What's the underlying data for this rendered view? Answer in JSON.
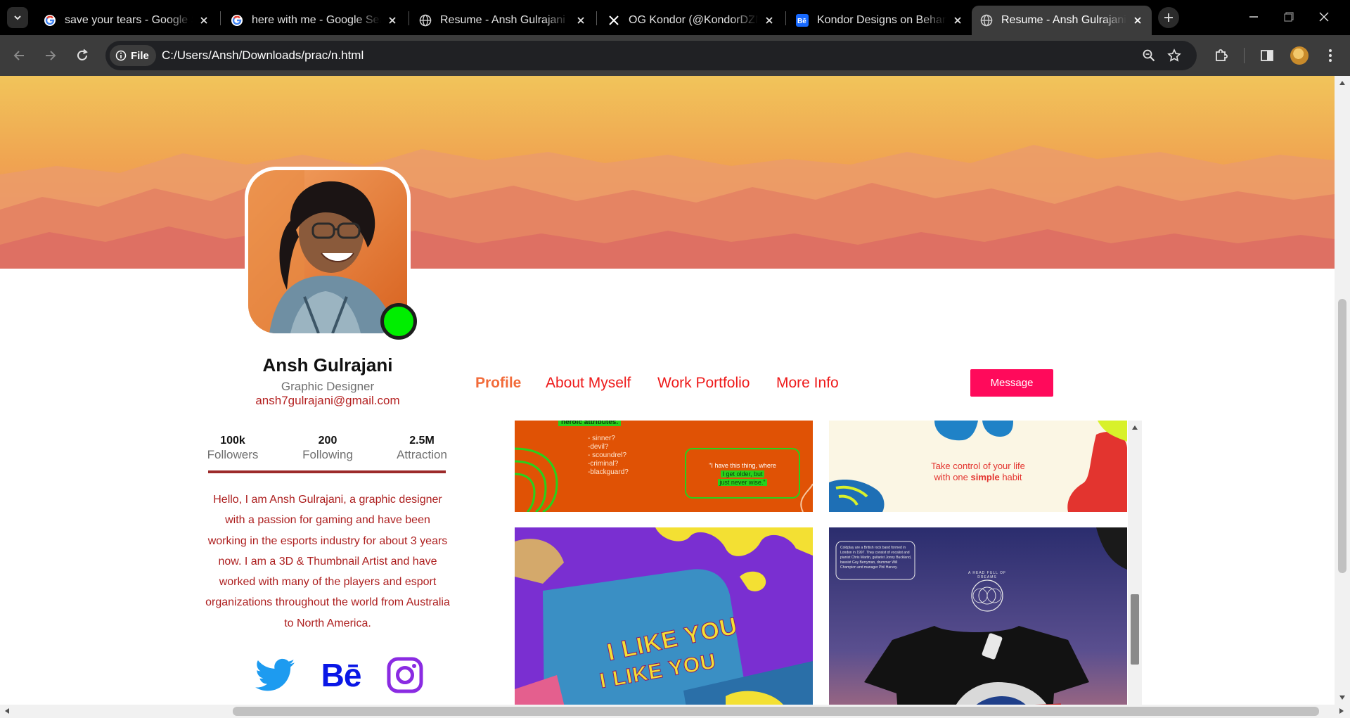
{
  "browser": {
    "tabs": [
      {
        "title": "save your tears - Google Search",
        "icon": "google-icon",
        "active": false
      },
      {
        "title": "here with me - Google Search",
        "icon": "google-icon",
        "active": false
      },
      {
        "title": "Resume - Ansh Gulrajani",
        "icon": "globe-icon",
        "active": false
      },
      {
        "title": "OG Kondor (@KondorDZN) / X",
        "icon": "x-icon",
        "active": false
      },
      {
        "title": "Kondor Designs on Behance",
        "icon": "behance-icon",
        "active": false
      },
      {
        "title": "Resume - Ansh Gulrajani",
        "icon": "globe-icon",
        "active": true
      }
    ],
    "site_chip": "File",
    "url": "C:/Users/Ansh/Downloads/prac/n.html"
  },
  "profile": {
    "name": "Ansh Gulrajani",
    "role": "Graphic Designer",
    "email": "ansh7gulrajani@gmail.com",
    "online": true,
    "stats": [
      {
        "value": "100k",
        "label": "Followers"
      },
      {
        "value": "200",
        "label": "Following"
      },
      {
        "value": "2.5M",
        "label": "Attraction"
      }
    ],
    "bio": "Hello, I am Ansh Gulrajani, a graphic designer with a passion for gaming and have been working in the esports industry for about 3 years now. I am a 3D & Thumbnail Artist and have worked with many of the players and esport organizations throughout the world from Australia to North America.",
    "social": [
      "twitter-icon",
      "behance-icon",
      "instagram-icon"
    ],
    "behance_mark": "Bē"
  },
  "nav": {
    "links": [
      "Profile",
      "About Myself",
      "Work Portfolio",
      "More Info"
    ],
    "active": "Profile",
    "message_label": "Message"
  },
  "gallery": {
    "card1": {
      "tag": "heroic attributes.",
      "list": [
        "- sinner?",
        "-devil?",
        "- scoundrel?",
        "-criminal?",
        "-blackguard?"
      ],
      "quote_line1": "\"I have this thing, where",
      "quote_line2": "I get older, but",
      "quote_line3": "just never wise.\""
    },
    "card2": {
      "line1": "Take control of your life",
      "line2_pre": "with one ",
      "line2_bold": "simple",
      "line2_post": " habit"
    },
    "card3": {
      "text1": "I LIKE YOU",
      "text2": "I LIKE YOU"
    },
    "card4": {
      "info": "Coldplay are a British rock band formed in London in 1997. They consist of vocalist and pianist Chris Martin, guitarist Jonny Buckland, bassist Guy Berryman, drummer Will Champion and manager Phil Harvey.",
      "ring_text": "A HEAD FULL OF DREAMS"
    }
  },
  "colors": {
    "accent_red": "#ee1a1a",
    "active_orange": "#f26b3a",
    "message_pink": "#ff0a5b",
    "status_green": "#00ee00",
    "bio_red": "#ad1f1f"
  }
}
